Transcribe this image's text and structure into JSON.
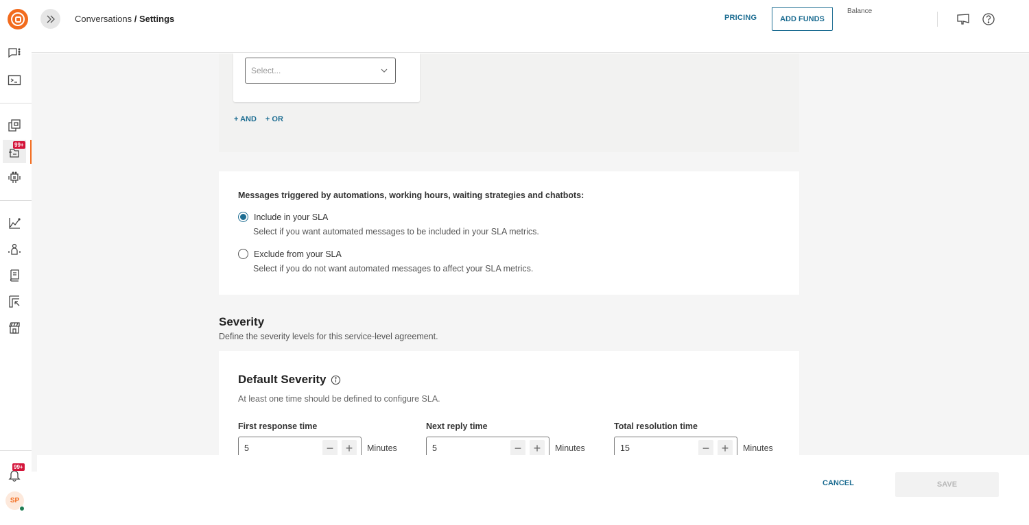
{
  "header": {
    "breadcrumb_parent": "Conversations",
    "breadcrumb_separator": " / ",
    "breadcrumb_current": "Settings",
    "pricing_label": "PRICING",
    "add_funds_label": "ADD FUNDS",
    "balance_label": "Balance"
  },
  "sidebar": {
    "items": [
      {
        "name": "conversations",
        "icon": "chat-icon"
      },
      {
        "name": "console",
        "icon": "terminal-icon"
      },
      {
        "name": "templates",
        "icon": "copy-icon"
      },
      {
        "name": "inbox",
        "icon": "inbox-icon",
        "badge": "99+",
        "active": true
      },
      {
        "name": "chatbots",
        "icon": "robot-icon"
      },
      {
        "name": "analytics",
        "icon": "chart-icon"
      },
      {
        "name": "people",
        "icon": "people-icon"
      },
      {
        "name": "knowledge",
        "icon": "book-icon"
      },
      {
        "name": "apps",
        "icon": "apps-icon"
      },
      {
        "name": "marketplace",
        "icon": "store-icon"
      }
    ],
    "notifications_badge": "99+",
    "avatar_initials": "SP",
    "colors": {
      "accent": "#f26b1d",
      "badge": "#d4153a",
      "online": "#1e7c52"
    }
  },
  "conditions": {
    "select_placeholder": "Select...",
    "and_label": "+ AND",
    "or_label": "+ OR"
  },
  "automated": {
    "title": "Messages triggered by automations, working hours, waiting strategies and chatbots:",
    "options": [
      {
        "label": "Include in your SLA",
        "description": "Select if you want automated messages to be included in your SLA metrics.",
        "checked": true
      },
      {
        "label": "Exclude from your SLA",
        "description": "Select if you do not want automated messages to affect your SLA metrics.",
        "checked": false
      }
    ]
  },
  "severity": {
    "title": "Severity",
    "description": "Define the severity levels for this service-level agreement.",
    "default_title": "Default Severity",
    "default_description": "At least one time should be defined to configure SLA.",
    "fields": [
      {
        "label": "First response time",
        "value": "5",
        "unit": "Minutes"
      },
      {
        "label": "Next reply time",
        "value": "5",
        "unit": "Minutes"
      },
      {
        "label": "Total resolution time",
        "value": "15",
        "unit": "Minutes"
      }
    ],
    "minus_symbol": "−",
    "plus_symbol": "+"
  },
  "footer": {
    "cancel_label": "CANCEL",
    "save_label": "SAVE"
  },
  "colors": {
    "primary": "#1d6d92"
  }
}
